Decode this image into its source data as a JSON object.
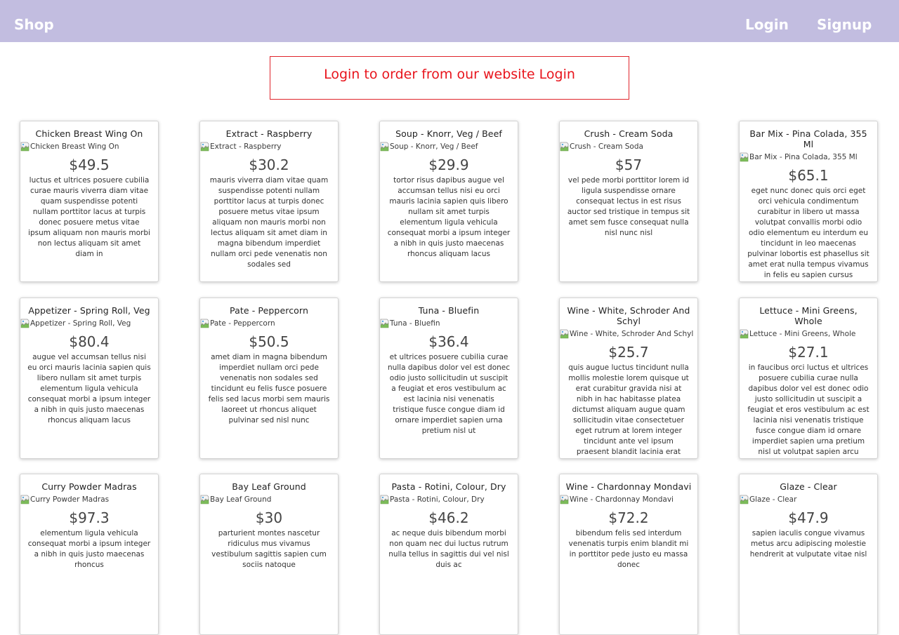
{
  "navbar": {
    "brand": "Shop",
    "login_label": "Login",
    "signup_label": "Signup",
    "background": "#c2bde0"
  },
  "alert": {
    "text": "Login to order from our website Login",
    "color": "#e8141c"
  },
  "products": [
    {
      "name": "Chicken Breast Wing On",
      "image_alt": "Chicken Breast Wing On",
      "price": "$49.5",
      "description": "luctus et ultrices posuere cubilia curae mauris viverra diam vitae quam suspendisse potenti nullam porttitor lacus at turpis donec posuere metus vitae ipsum aliquam non mauris morbi non lectus aliquam sit amet diam in"
    },
    {
      "name": "Extract - Raspberry",
      "image_alt": "Extract - Raspberry",
      "price": "$30.2",
      "description": "mauris viverra diam vitae quam suspendisse potenti nullam porttitor lacus at turpis donec posuere metus vitae ipsum aliquam non mauris morbi non lectus aliquam sit amet diam in magna bibendum imperdiet nullam orci pede venenatis non sodales sed"
    },
    {
      "name": "Soup - Knorr, Veg / Beef",
      "image_alt": "Soup - Knorr, Veg / Beef",
      "price": "$29.9",
      "description": "tortor risus dapibus augue vel accumsan tellus nisi eu orci mauris lacinia sapien quis libero nullam sit amet turpis elementum ligula vehicula consequat morbi a ipsum integer a nibh in quis justo maecenas rhoncus aliquam lacus"
    },
    {
      "name": "Crush - Cream Soda",
      "image_alt": "Crush - Cream Soda",
      "price": "$57",
      "description": "vel pede morbi porttitor lorem id ligula suspendisse ornare consequat lectus in est risus auctor sed tristique in tempus sit amet sem fusce consequat nulla nisl nunc nisl"
    },
    {
      "name": "Bar Mix - Pina Colada, 355 Ml",
      "image_alt": "Bar Mix - Pina Colada, 355 Ml",
      "price": "$65.1",
      "description": "eget nunc donec quis orci eget orci vehicula condimentum curabitur in libero ut massa volutpat convallis morbi odio odio elementum eu interdum eu tincidunt in leo maecenas pulvinar lobortis est phasellus sit amet erat nulla tempus vivamus in felis eu sapien cursus vestibulum proin eu mi nulla ac enim"
    },
    {
      "name": "Appetizer - Spring Roll, Veg",
      "image_alt": "Appetizer - Spring Roll, Veg",
      "price": "$80.4",
      "description": "augue vel accumsan tellus nisi eu orci mauris lacinia sapien quis libero nullam sit amet turpis elementum ligula vehicula consequat morbi a ipsum integer a nibh in quis justo maecenas rhoncus aliquam lacus"
    },
    {
      "name": "Pate - Peppercorn",
      "image_alt": "Pate - Peppercorn",
      "price": "$50.5",
      "description": "amet diam in magna bibendum imperdiet nullam orci pede venenatis non sodales sed tincidunt eu felis fusce posuere felis sed lacus morbi sem mauris laoreet ut rhoncus aliquet pulvinar sed nisl nunc"
    },
    {
      "name": "Tuna - Bluefin",
      "image_alt": "Tuna - Bluefin",
      "price": "$36.4",
      "description": "et ultrices posuere cubilia curae nulla dapibus dolor vel est donec odio justo sollicitudin ut suscipit a feugiat et eros vestibulum ac est lacinia nisi venenatis tristique fusce congue diam id ornare imperdiet sapien urna pretium nisl ut"
    },
    {
      "name": "Wine - White, Schroder And Schyl",
      "image_alt": "Wine - White, Schroder And Schyl",
      "price": "$25.7",
      "description": "quis augue luctus tincidunt nulla mollis molestie lorem quisque ut erat curabitur gravida nisi at nibh in hac habitasse platea dictumst aliquam augue quam sollicitudin vitae consectetuer eget rutrum at lorem integer tincidunt ante vel ipsum praesent blandit lacinia erat"
    },
    {
      "name": "Lettuce - Mini Greens, Whole",
      "image_alt": "Lettuce - Mini Greens, Whole",
      "price": "$27.1",
      "description": "in faucibus orci luctus et ultrices posuere cubilia curae nulla dapibus dolor vel est donec odio justo sollicitudin ut suscipit a feugiat et eros vestibulum ac est lacinia nisi venenatis tristique fusce congue diam id ornare imperdiet sapien urna pretium nisl ut volutpat sapien arcu"
    },
    {
      "name": "Curry Powder Madras",
      "image_alt": "Curry Powder Madras",
      "price": "$97.3",
      "description": "elementum ligula vehicula consequat morbi a ipsum integer a nibh in quis justo maecenas rhoncus"
    },
    {
      "name": "Bay Leaf Ground",
      "image_alt": "Bay Leaf Ground",
      "price": "$30",
      "description": "parturient montes nascetur ridiculus mus vivamus vestibulum sagittis sapien cum sociis natoque"
    },
    {
      "name": "Pasta - Rotini, Colour, Dry",
      "image_alt": "Pasta - Rotini, Colour, Dry",
      "price": "$46.2",
      "description": "ac neque duis bibendum morbi non quam nec dui luctus rutrum nulla tellus in sagittis dui vel nisl duis ac"
    },
    {
      "name": "Wine - Chardonnay Mondavi",
      "image_alt": "Wine - Chardonnay Mondavi",
      "price": "$72.2",
      "description": "bibendum felis sed interdum venenatis turpis enim blandit mi in porttitor pede justo eu massa donec"
    },
    {
      "name": "Glaze - Clear",
      "image_alt": "Glaze - Clear",
      "price": "$47.9",
      "description": "sapien iaculis congue vivamus metus arcu adipiscing molestie hendrerit at vulputate vitae nisl"
    }
  ]
}
